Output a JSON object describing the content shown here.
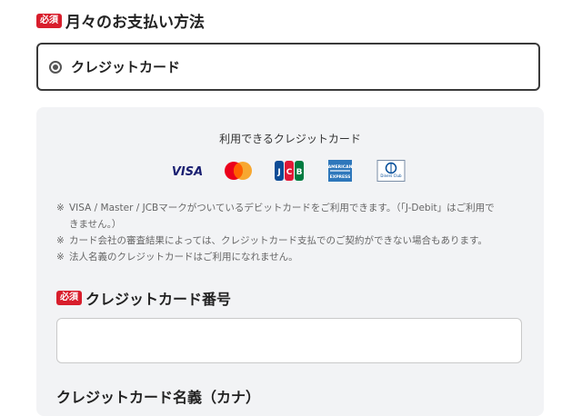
{
  "payment_method": {
    "required_badge": "必須",
    "heading": "月々のお支払い方法",
    "selected_option_label": "クレジットカード"
  },
  "credit_panel": {
    "title": "利用できるクレジットカード",
    "logos": [
      "visa-logo",
      "mastercard-logo",
      "jcb-logo",
      "amex-logo",
      "diners-logo"
    ],
    "notes": [
      {
        "mark": "※",
        "text": "VISA / Master / JCBマークがついているデビットカードをご利用できます。（「J-Debit」はご利用で"
      },
      {
        "mark": "",
        "text": "きません。）"
      },
      {
        "mark": "※",
        "text": "カード会社の審査結果によっては、クレジットカード支払でのご契約ができない場合もあります。"
      },
      {
        "mark": "※",
        "text": "法人名義のクレジットカードはご利用になれません。"
      }
    ],
    "card_number_badge": "必須",
    "card_number_heading": "クレジットカード番号",
    "card_number_value": "",
    "card_name_heading": "クレジットカード名義（カナ）"
  },
  "colors": {
    "badge": "#d81e2c",
    "panel_bg": "#f2f3f5",
    "visa": "#1a1f71",
    "master_red": "#eb001b",
    "master_orange": "#f79e1b",
    "jcb_blue": "#0e4c96",
    "amex": "#2e77bb"
  }
}
